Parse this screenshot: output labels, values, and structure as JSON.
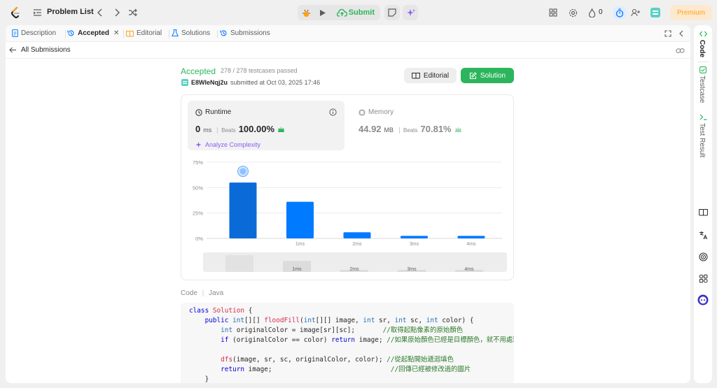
{
  "topbar": {
    "title": "Problem List",
    "submit_label": "Submit",
    "streak_count": "0",
    "premium_label": "Premium"
  },
  "tabs": [
    {
      "label": "Description",
      "icon": "document-icon"
    },
    {
      "label": "Accepted",
      "icon": "history-icon"
    },
    {
      "label": "Editorial",
      "icon": "book-icon"
    },
    {
      "label": "Solutions",
      "icon": "flask-icon"
    },
    {
      "label": "Submissions",
      "icon": "history-icon"
    }
  ],
  "subheader": {
    "back_label": "All Submissions"
  },
  "submission": {
    "status": "Accepted",
    "testcases": "278 / 278 testcases passed",
    "username": "E8WIeNqj2u",
    "submitted_text": "submitted at Oct 03, 2025 17:46",
    "editorial_label": "Editorial",
    "solution_label": "Solution"
  },
  "runtime": {
    "label": "Runtime",
    "value": "0",
    "unit": "ms",
    "beats_label": "Beats",
    "beats_pct": "100.00%",
    "analyze_label": "Analyze Complexity"
  },
  "memory": {
    "label": "Memory",
    "value": "44.92",
    "unit": "MB",
    "beats_label": "Beats",
    "beats_pct": "70.81%"
  },
  "chart_data": {
    "type": "bar",
    "categories": [
      "0ms",
      "1ms",
      "2ms",
      "3ms",
      "4ms"
    ],
    "values": [
      55,
      36,
      6,
      2.5,
      2.5
    ],
    "ytick_labels": [
      "0%",
      "25%",
      "50%",
      "75%"
    ],
    "yticks": [
      0,
      25,
      50,
      75
    ],
    "ylim": [
      0,
      75
    ],
    "xtick_labels": [
      "",
      "1ms",
      "2ms",
      "3ms",
      "4ms"
    ],
    "highlight_index": 0,
    "bar_color": "#007aff",
    "highlight_color": "#0a6bd8"
  },
  "overview": {
    "values": [
      55,
      36,
      6,
      2.5,
      2.5
    ],
    "labels": [
      "",
      "1ms",
      "2ms",
      "3ms",
      "4ms"
    ]
  },
  "code_section": {
    "label": "Code",
    "language": "Java",
    "lines": [
      [
        [
          "kw",
          "class "
        ],
        [
          "cl",
          "Solution "
        ],
        [
          "nm",
          "{"
        ]
      ],
      [
        [
          "nm",
          "    "
        ],
        [
          "kw",
          "public "
        ],
        [
          "ty",
          "int"
        ],
        [
          "nm",
          "[][] "
        ],
        [
          "cl",
          "floodFill"
        ],
        [
          "nm",
          "("
        ],
        [
          "ty",
          "int"
        ],
        [
          "nm",
          "[][] image, "
        ],
        [
          "ty",
          "int"
        ],
        [
          "nm",
          " sr, "
        ],
        [
          "ty",
          "int"
        ],
        [
          "nm",
          " sc, "
        ],
        [
          "ty",
          "int"
        ],
        [
          "nm",
          " color) {"
        ]
      ],
      [
        [
          "nm",
          "        "
        ],
        [
          "ty",
          "int"
        ],
        [
          "nm",
          " originalColor = image[sr][sc];       "
        ],
        [
          "cm",
          "//取得起點像素的原始顏色"
        ]
      ],
      [
        [
          "nm",
          "        "
        ],
        [
          "kw",
          "if "
        ],
        [
          "nm",
          "(originalColor == color) "
        ],
        [
          "kw",
          "return "
        ],
        [
          "nm",
          "image; "
        ],
        [
          "cm",
          "//如果原始顏色已經是目標顏色，就不用處理"
        ]
      ],
      [
        [
          "nm",
          ""
        ]
      ],
      [
        [
          "nm",
          "        "
        ],
        [
          "cl",
          "dfs"
        ],
        [
          "nm",
          "(image, sr, sc, originalColor, color); "
        ],
        [
          "cm",
          "//從起點開始遞迴填色"
        ]
      ],
      [
        [
          "nm",
          "        "
        ],
        [
          "kw",
          "return "
        ],
        [
          "nm",
          "image;                              "
        ],
        [
          "cm",
          "//回傳已經被修改過的圖片"
        ]
      ],
      [
        [
          "nm",
          "    }"
        ]
      ]
    ]
  },
  "rail": {
    "code_label": "Code",
    "testcase_label": "Testcase",
    "result_label": "Test Result"
  },
  "colors": {
    "accent_green": "#2db55d",
    "premium": "#ffa116",
    "analyze": "#8a5cf6"
  }
}
